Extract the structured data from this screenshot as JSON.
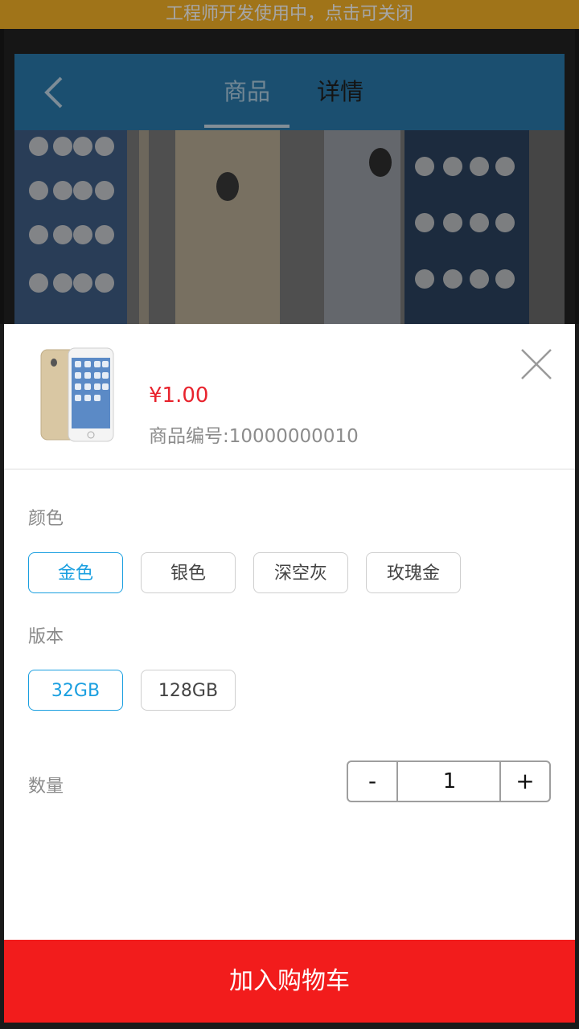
{
  "banner": {
    "text": "工程师开发使用中，点击可关闭"
  },
  "header": {
    "back_icon": "chevron-left-icon",
    "tabs": [
      {
        "label": "商品",
        "active": true
      },
      {
        "label": "详情",
        "active": false
      }
    ]
  },
  "sheet": {
    "price": "¥1.00",
    "sku": "商品编号:10000000010",
    "close_icon": "close-icon",
    "color_section": {
      "label": "颜色",
      "options": [
        "金色",
        "银色",
        "深空灰",
        "玫瑰金"
      ],
      "selected": "金色"
    },
    "version_section": {
      "label": "版本",
      "options": [
        "32GB",
        "128GB"
      ],
      "selected": "32GB"
    },
    "quantity": {
      "label": "数量",
      "minus": "-",
      "value": "1",
      "plus": "+"
    },
    "add_to_cart": "加入购物车"
  },
  "colors": {
    "banner": "#f6b327",
    "header": "#2a7aad",
    "accent": "#1a9fe0",
    "price": "#e8232d",
    "cta": "#f21c1c"
  }
}
